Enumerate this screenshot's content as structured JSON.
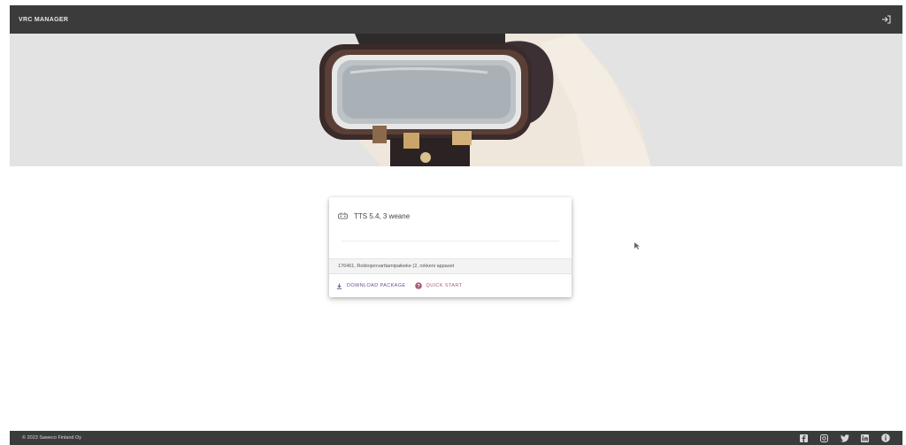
{
  "app": {
    "title": "VRC MANAGER"
  },
  "header": {
    "logout_icon": "logout-icon"
  },
  "hero": {
    "image": "vr-headset-illustration"
  },
  "card": {
    "icon": "headset-icon",
    "name": "TTS 5.4, 3 weane",
    "meta": "176461, Rokkojenvarttamipaikeke (2, rokkeni appaset",
    "actions": [
      {
        "label": "DOWNLOAD PACKAGE",
        "icon": "download-icon"
      },
      {
        "label": "QUICK START",
        "icon": "help-icon"
      }
    ]
  },
  "footer": {
    "copyright": "© 2023 Saweco Finland Oy",
    "socials": [
      {
        "name": "facebook",
        "icon": "facebook-icon"
      },
      {
        "name": "instagram",
        "icon": "instagram-icon"
      },
      {
        "name": "twitter",
        "icon": "twitter-icon"
      },
      {
        "name": "linkedin",
        "icon": "linkedin-icon"
      },
      {
        "name": "info",
        "icon": "info-icon"
      }
    ]
  },
  "colors": {
    "bar": "#3b3b3b",
    "hero_bg": "#e3e3e3",
    "download_accent": "#6a4e8e",
    "quickstart_accent": "#a85a7a"
  }
}
